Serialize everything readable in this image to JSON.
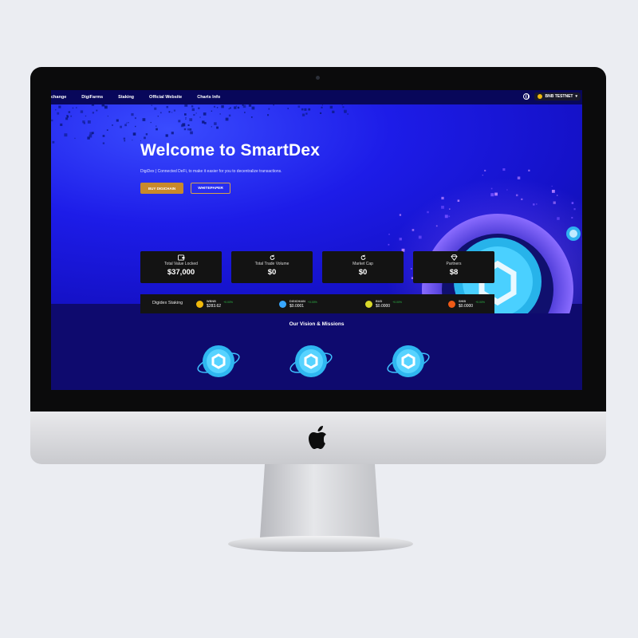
{
  "navbar": {
    "links": [
      "change",
      "DigiFarms",
      "Staking",
      "Official Website",
      "Charts Info"
    ],
    "network_label": "BNB TESTNET",
    "network_caret": "▾"
  },
  "hero": {
    "title": "Welcome to SmartDex",
    "subtitle": "DigiDex | Connected DeFi, to make it easier for you to decentralize transactions.",
    "buy_button": "BUY DIGICHAIN",
    "whitepaper_button": "WHITEPAPER"
  },
  "stats": [
    {
      "label": "Total Value Locked",
      "value": "$37,000",
      "icon": "wallet-icon"
    },
    {
      "label": "Total Trade Volume",
      "value": "$0",
      "icon": "refresh-icon"
    },
    {
      "label": "Market Cap",
      "value": "$0",
      "icon": "refresh-icon"
    },
    {
      "label": "Partners",
      "value": "$8",
      "icon": "diamond-icon"
    }
  ],
  "ticker": {
    "title": "Digidex Staking",
    "items": [
      {
        "symbol": "WBNB",
        "price": "$283.62",
        "change": "+0.00%",
        "color": "#f0b90b"
      },
      {
        "symbol": "DIGICHAIN",
        "price": "$0.0001",
        "change": "+0.00%",
        "color": "#38a7ff"
      },
      {
        "symbol": "BUD",
        "price": "$0.0000",
        "change": "+0.00%",
        "color": "#d9d92a"
      },
      {
        "symbol": "SHIB",
        "price": "$0.0000",
        "change": "+0.00%",
        "color": "#ef5a16"
      }
    ]
  },
  "vision": {
    "title": "Our Vision & Missions"
  },
  "colors": {
    "accent_gold": "#c8892b",
    "hero_blue": "#1d1ce8",
    "page_navy": "#0e0a6e",
    "card_dark": "#131313",
    "positive_green": "#2fbf4a"
  }
}
